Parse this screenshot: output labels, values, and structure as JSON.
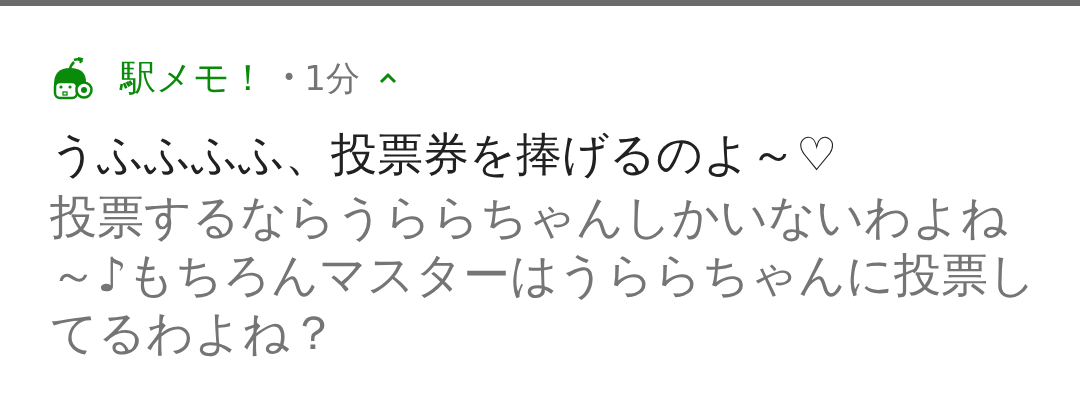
{
  "notification": {
    "app_name": "駅メモ！",
    "separator": "•",
    "time": "1分",
    "expanded": true,
    "title": "うふふふふ、投票券を捧げるのよ～♡",
    "body": "投票するならうららちゃんしかいないわよね～♪もちろんマスターはうららちゃんに投票してるわよね？"
  }
}
